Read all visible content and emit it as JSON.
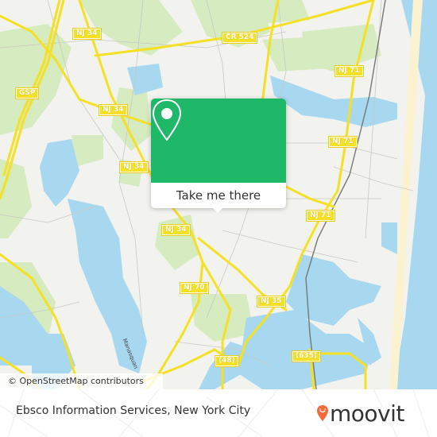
{
  "map": {
    "road_labels": [
      {
        "id": "nj34-a",
        "text": "NJ 34"
      },
      {
        "id": "cr524",
        "text": "CR 524"
      },
      {
        "id": "gsp",
        "text": "GSP"
      },
      {
        "id": "nj34-b",
        "text": "NJ 34"
      },
      {
        "id": "nj34-c",
        "text": "NJ 34"
      },
      {
        "id": "nj71-a",
        "text": "NJ 71"
      },
      {
        "id": "nj71-b",
        "text": "NJ 71"
      },
      {
        "id": "nj71-c",
        "text": "NJ 71"
      },
      {
        "id": "nj34-d",
        "text": "NJ 34"
      },
      {
        "id": "nj70",
        "text": "NJ 70"
      },
      {
        "id": "nj35",
        "text": "NJ 35"
      },
      {
        "id": "r48",
        "text": "(48)"
      },
      {
        "id": "r635",
        "text": "(635)"
      }
    ],
    "water_label": "Manasquan",
    "attribution": "© OpenStreetMap contributors",
    "colors": {
      "land": "#f2f2ef",
      "park": "#d6ebbf",
      "water": "#a8d8ef",
      "road": "#f4e024",
      "beach": "#fbf3cf"
    }
  },
  "popup": {
    "icon": "map-pin-icon",
    "button_label": "Take me there",
    "color": "#1fb868"
  },
  "footer": {
    "title": "Ebsco Information Services, New York City",
    "brand": "moovit",
    "brand_color": "#f26b3a"
  }
}
